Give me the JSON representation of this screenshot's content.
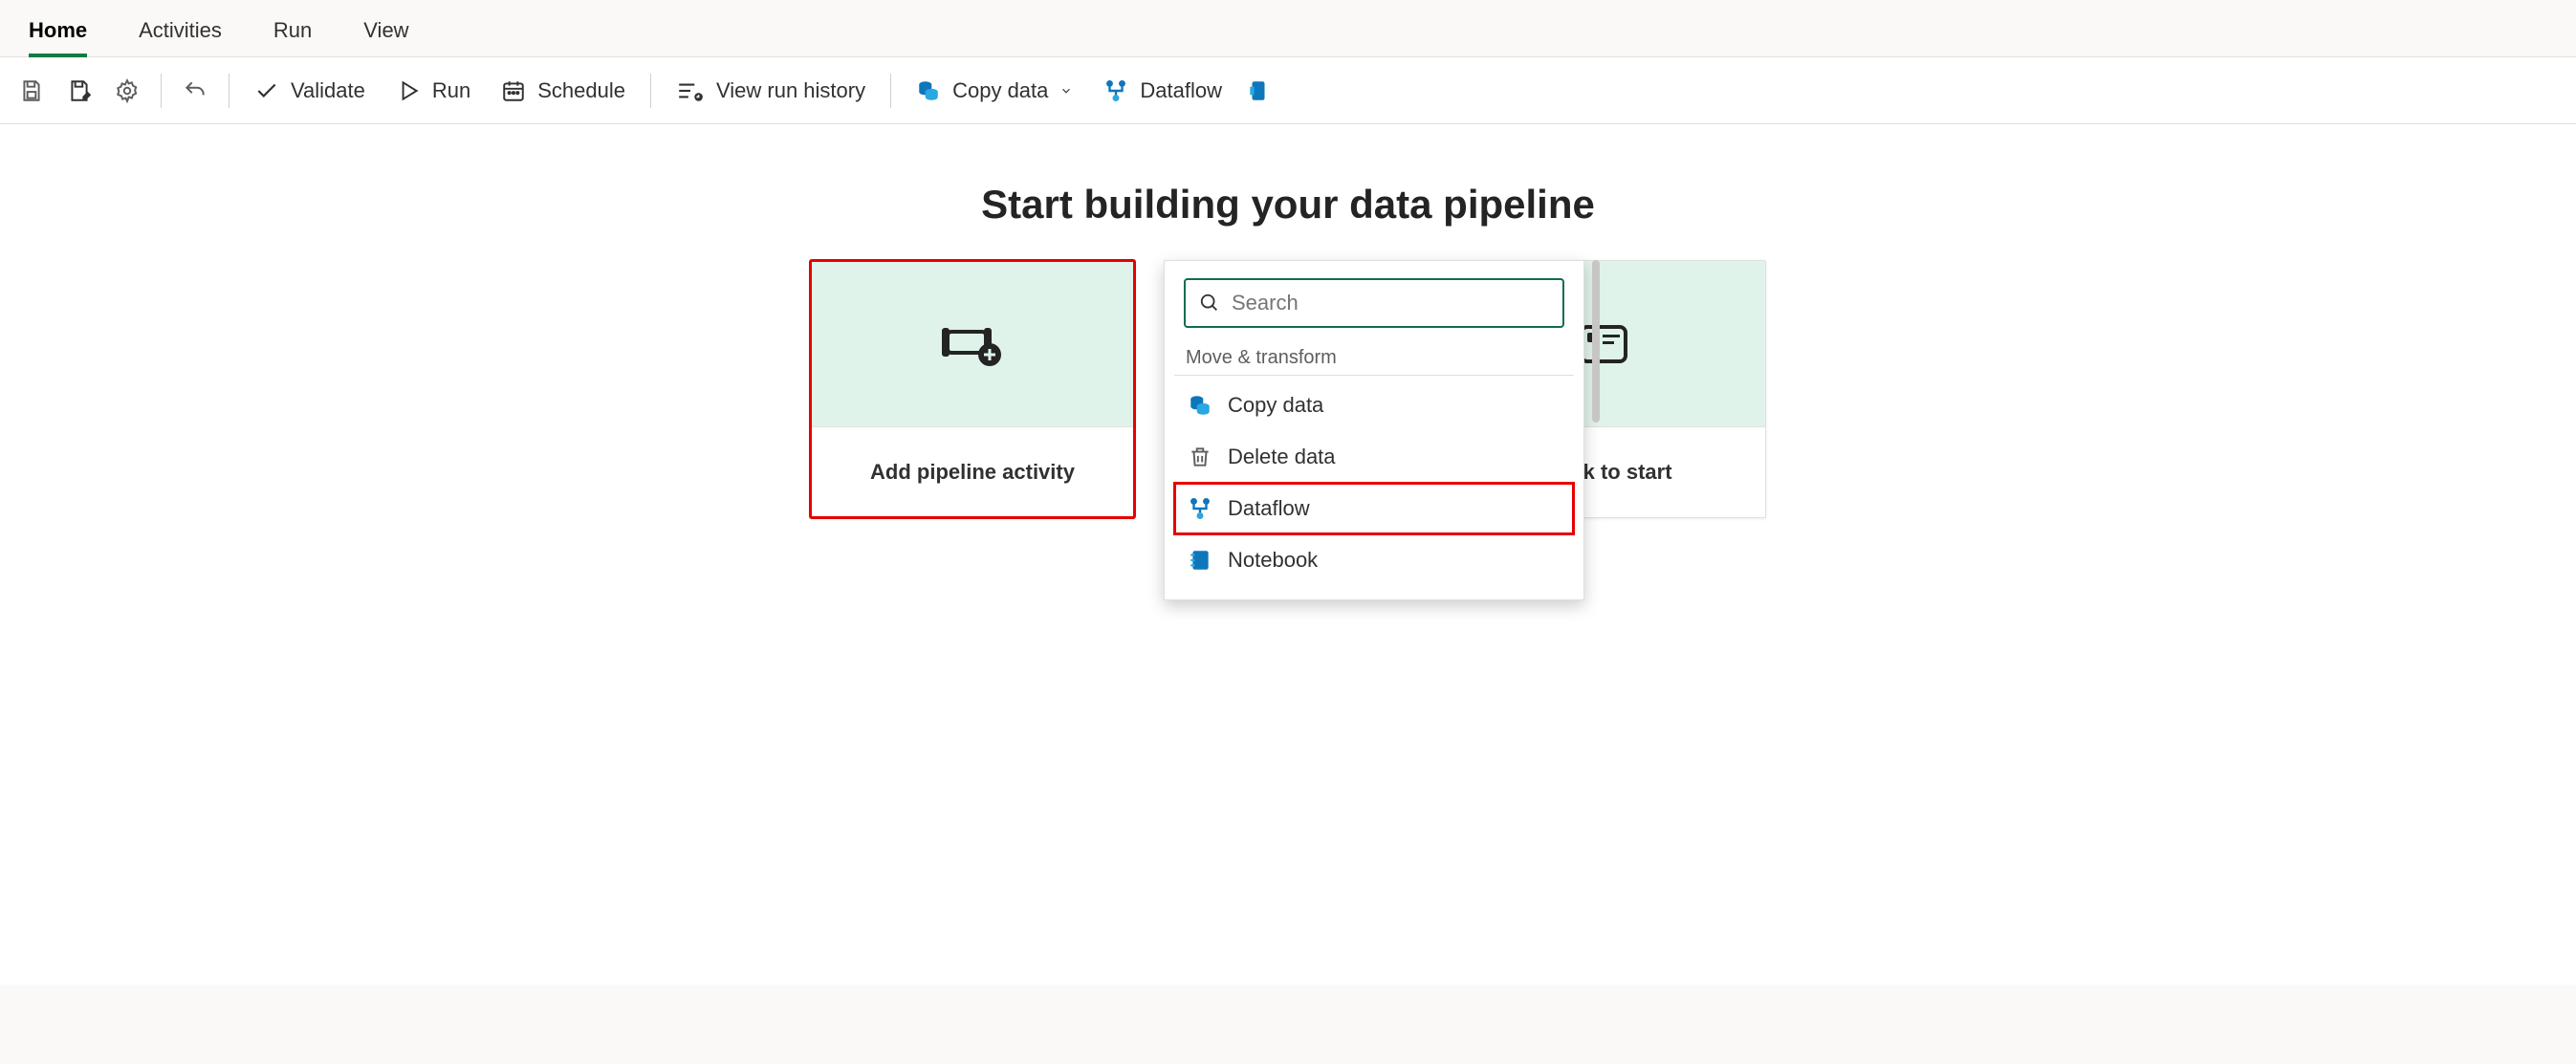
{
  "tabs": {
    "home": "Home",
    "activities": "Activities",
    "run": "Run",
    "view": "View"
  },
  "toolbar": {
    "validate": "Validate",
    "run": "Run",
    "schedule": "Schedule",
    "viewHistory": "View run history",
    "copyData": "Copy data",
    "dataflow": "Dataflow"
  },
  "page": {
    "title": "Start building your data pipeline",
    "cardAddActivity": "Add pipeline activity",
    "cardTaskStart": "a task to start"
  },
  "popup": {
    "searchPlaceholder": "Search",
    "groupLabel": "Move & transform",
    "items": {
      "copyData": "Copy data",
      "deleteData": "Delete data",
      "dataflow": "Dataflow",
      "notebook": "Notebook"
    }
  }
}
